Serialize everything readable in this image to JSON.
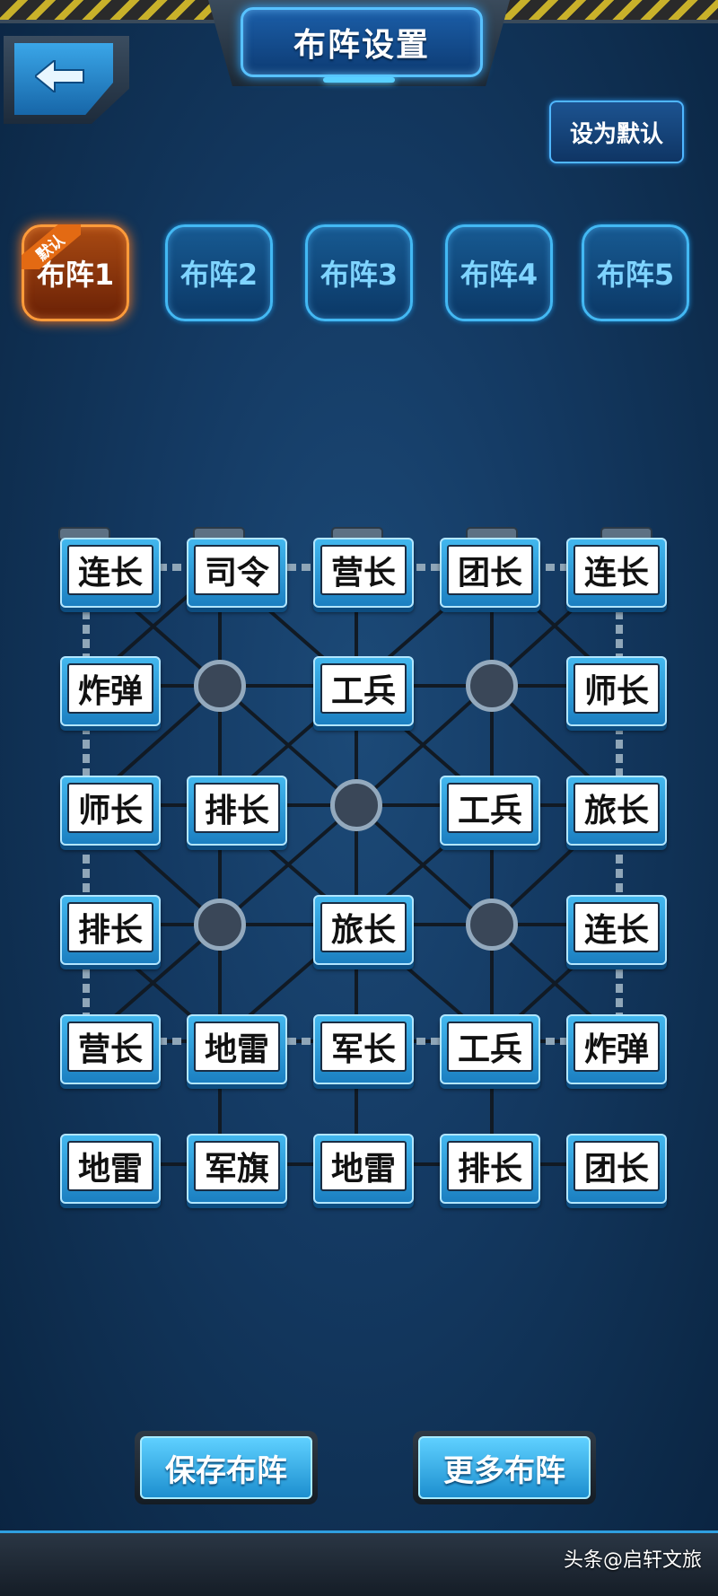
{
  "header": {
    "title": "布阵设置",
    "back_icon": "arrow-left-icon"
  },
  "set_default_label": "设为默认",
  "tabs": [
    {
      "label": "布阵1",
      "active": true,
      "badge": "默认"
    },
    {
      "label": "布阵2",
      "active": false
    },
    {
      "label": "布阵3",
      "active": false
    },
    {
      "label": "布阵4",
      "active": false
    },
    {
      "label": "布阵5",
      "active": false
    }
  ],
  "board": {
    "rows": [
      [
        "连长",
        "司令",
        "营长",
        "团长",
        "连长"
      ],
      [
        "炸弹",
        "",
        "工兵",
        "",
        "师长"
      ],
      [
        "师长",
        "排长",
        "",
        "工兵",
        "旅长"
      ],
      [
        "排长",
        "",
        "旅长",
        "",
        "连长"
      ],
      [
        "营长",
        "地雷",
        "军长",
        "工兵",
        "炸弹"
      ],
      [
        "地雷",
        "军旗",
        "地雷",
        "排长",
        "团长"
      ]
    ]
  },
  "actions": {
    "save_label": "保存布阵",
    "more_label": "更多布阵"
  },
  "watermark": "头条@启轩文旅",
  "colors": {
    "accent": "#43b8f3",
    "active_tab": "#ff9b3a",
    "background": "#143a63"
  }
}
